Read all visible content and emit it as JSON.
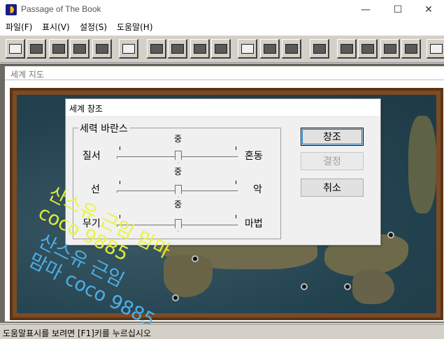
{
  "app": {
    "title": "Passage of The Book",
    "window_buttons": {
      "minimize": "—",
      "maximize": "☐",
      "close": "✕"
    }
  },
  "menubar": {
    "items": [
      {
        "label": "파일(F)"
      },
      {
        "label": "표시(V)"
      },
      {
        "label": "설정(S)"
      },
      {
        "label": "도움말(H)"
      }
    ]
  },
  "toolbar": {
    "icons": [
      "window-icon",
      "card-icon",
      "map-icon",
      "list-icon",
      "table-icon",
      "sparkle-icon",
      "shield-sword-icon",
      "star-icon",
      "bag-icon",
      "panel-icon",
      "lips-icon",
      "hand-give-icon",
      "info-person-icon",
      "open-hand-icon",
      "grid-icon",
      "key-icon",
      "copy-icon",
      "pyramid-icon",
      "help-icon"
    ]
  },
  "child_window": {
    "title": "세계 지도"
  },
  "dialog": {
    "title": "세계 창조",
    "group_title": "세력 바란스",
    "sliders": [
      {
        "left": "질서",
        "mid": "중",
        "right": "혼동",
        "level": 0.5
      },
      {
        "left": "선",
        "mid": "중",
        "right": "악",
        "level": 0.5
      },
      {
        "left": "무기",
        "mid": "중",
        "right": "마법",
        "level": 0.5
      }
    ],
    "buttons": {
      "create": "창조",
      "decide": "결정",
      "cancel": "취소"
    }
  },
  "watermarks": {
    "yellow": "산스유 근임 맘마\ncoco 9885",
    "blue": "산스유 근임\n맘마 coco 9885",
    "yellow_color": "#e9f53a",
    "blue_color": "#4fb4ee"
  },
  "statusbar": {
    "text": "도움말표시를 보려면 [F1]키를 누르십시오"
  }
}
